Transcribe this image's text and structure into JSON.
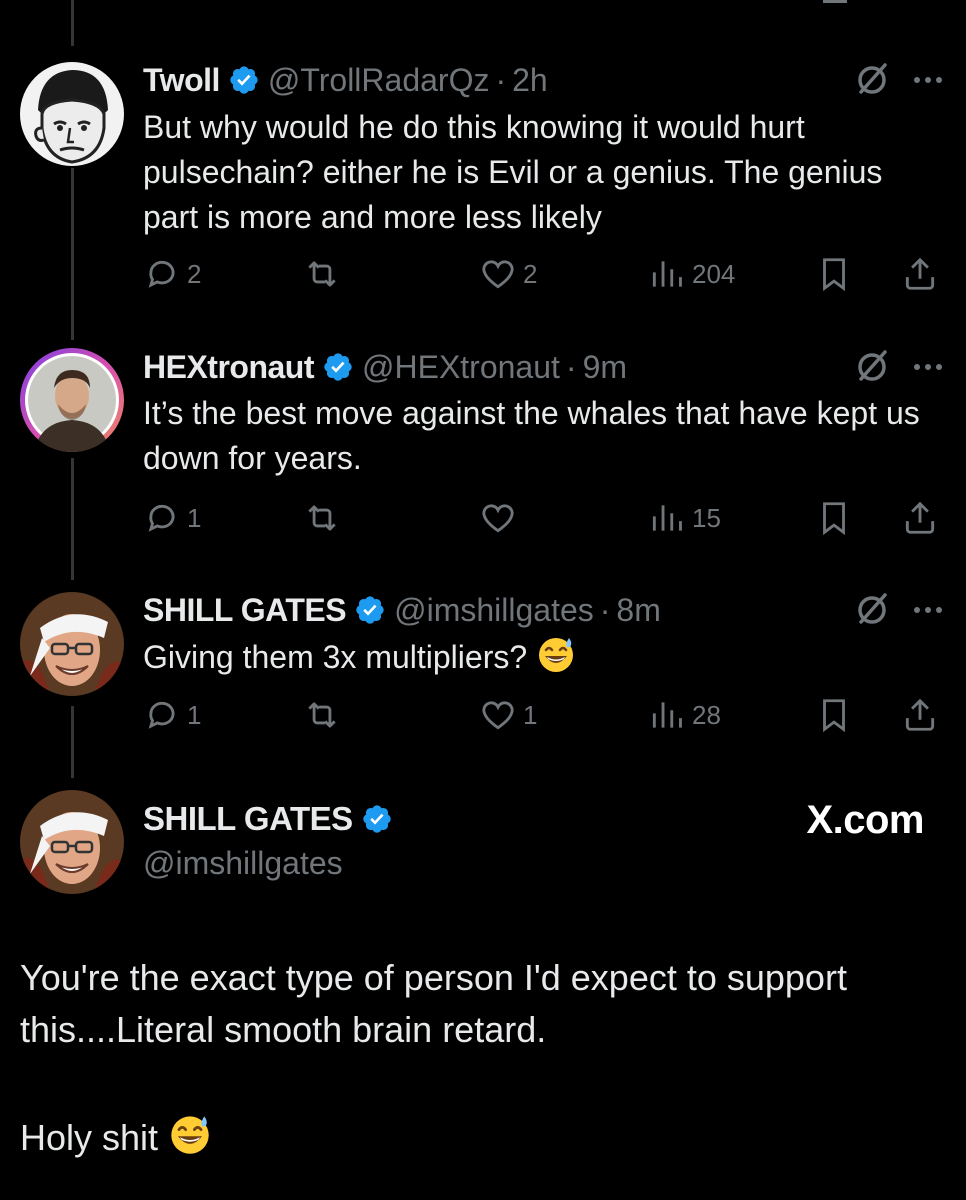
{
  "tweets": [
    {
      "name": "Twoll",
      "handle": "@TrollRadarQz",
      "time": "2h",
      "text": "But why would he do this knowing it would hurt pulsechain? either he is Evil or a genius. The genius part is more and more less likely",
      "replies": "2",
      "retweets": "",
      "likes": "2",
      "views": "204",
      "avatar_icon": "wojak-beanie-avatar"
    },
    {
      "name": "HEXtronaut",
      "handle": "@HEXtronaut",
      "time": "9m",
      "text": "It’s the best move against the whales that have kept us down for years.",
      "replies": "1",
      "retweets": "",
      "likes": "",
      "views": "15",
      "avatar_icon": "man-portrait-avatar"
    },
    {
      "name": "SHILL GATES",
      "handle": "@imshillgates",
      "time": "8m",
      "text": "Giving them 3x multipliers?",
      "replies": "1",
      "retweets": "",
      "likes": "1",
      "views": "28",
      "avatar_icon": "bill-gates-bandana-avatar"
    }
  ],
  "quote": {
    "name": "SHILL GATES",
    "handle": "@imshillgates",
    "brand": "X.com",
    "line1": "You're the exact type of person I'd expect to support this....Literal smooth brain retard.",
    "line2": "Holy shit"
  },
  "colors": {
    "background": "#000000",
    "text": "#e7e9ea",
    "muted": "#71767b",
    "verified": "#1d9bf0",
    "thread_line": "#333639"
  },
  "separator": "·"
}
